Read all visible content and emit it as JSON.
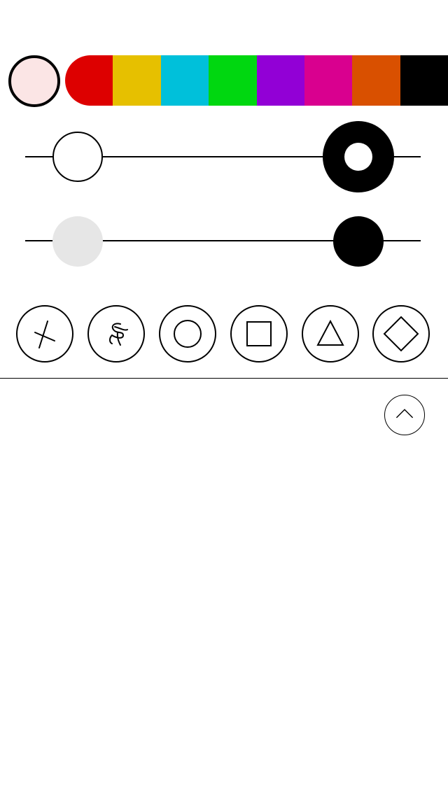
{
  "current_color": "#fbe5e5",
  "palette": [
    {
      "name": "red",
      "color": "#dd0000"
    },
    {
      "name": "yellow",
      "color": "#e6c000"
    },
    {
      "name": "cyan",
      "color": "#00c0da"
    },
    {
      "name": "green",
      "color": "#00d710"
    },
    {
      "name": "purple",
      "color": "#9200d6"
    },
    {
      "name": "magenta",
      "color": "#d9008f"
    },
    {
      "name": "orange",
      "color": "#d95000"
    },
    {
      "name": "black",
      "color": "#000000"
    }
  ],
  "sliders": {
    "brush_size": {
      "min_icon": "hollow-circle-icon",
      "max_icon": "ring-icon"
    },
    "opacity": {
      "min_icon": "faint-circle-icon",
      "max_icon": "solid-circle-icon"
    }
  },
  "tools": [
    {
      "id": "scribble-x",
      "icon": "scribble-x-icon"
    },
    {
      "id": "freehand",
      "icon": "freehand-icon"
    },
    {
      "id": "circle",
      "icon": "circle-shape-icon"
    },
    {
      "id": "square",
      "icon": "square-shape-icon"
    },
    {
      "id": "triangle",
      "icon": "triangle-shape-icon"
    },
    {
      "id": "diamond",
      "icon": "diamond-shape-icon"
    }
  ],
  "collapse": {
    "icon": "chevron-up-icon"
  }
}
